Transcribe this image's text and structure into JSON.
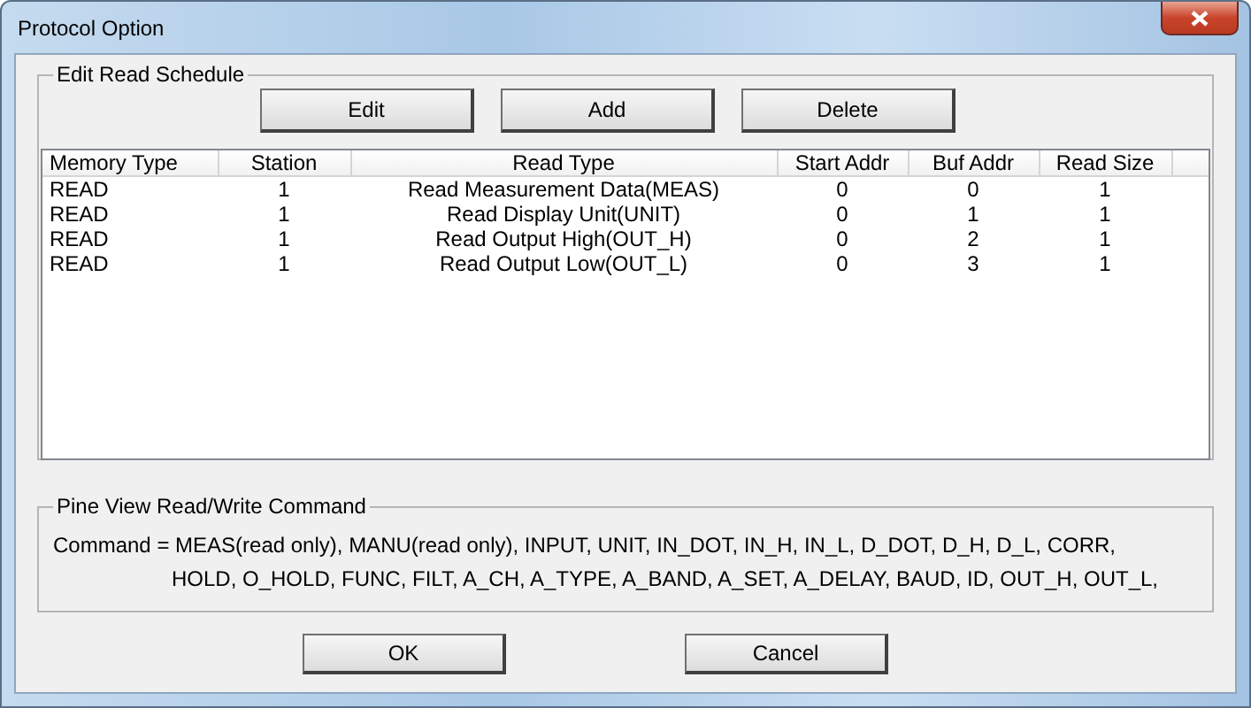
{
  "window": {
    "title": "Protocol Option"
  },
  "schedule": {
    "title": "Edit Read Schedule",
    "buttons": [
      "Edit",
      "Add",
      "Delete"
    ],
    "table": {
      "columns": [
        "Memory Type",
        "Station",
        "Read Type",
        "Start Addr",
        "Buf Addr",
        "Read Size"
      ],
      "rows": [
        [
          "READ",
          "1",
          "Read Measurement Data(MEAS)",
          "0",
          "0",
          "1"
        ],
        [
          "READ",
          "1",
          "Read Display Unit(UNIT)",
          "0",
          "1",
          "1"
        ],
        [
          "READ",
          "1",
          "Read Output High(OUT_H)",
          "0",
          "2",
          "1"
        ],
        [
          "READ",
          "1",
          "Read Output Low(OUT_L)",
          "0",
          "3",
          "1"
        ]
      ]
    }
  },
  "commands": {
    "title": "Pine View Read/Write Command",
    "lines": [
      "Command = MEAS(read only), MANU(read only), INPUT, UNIT, IN_DOT, IN_H, IN_L, D_DOT, D_H, D_L, CORR,",
      "HOLD, O_HOLD, FUNC, FILT, A_CH, A_TYPE, A_BAND, A_SET, A_DELAY, BAUD, ID, OUT_H, OUT_L,"
    ]
  },
  "buttons": [
    "OK",
    "Cancel"
  ]
}
